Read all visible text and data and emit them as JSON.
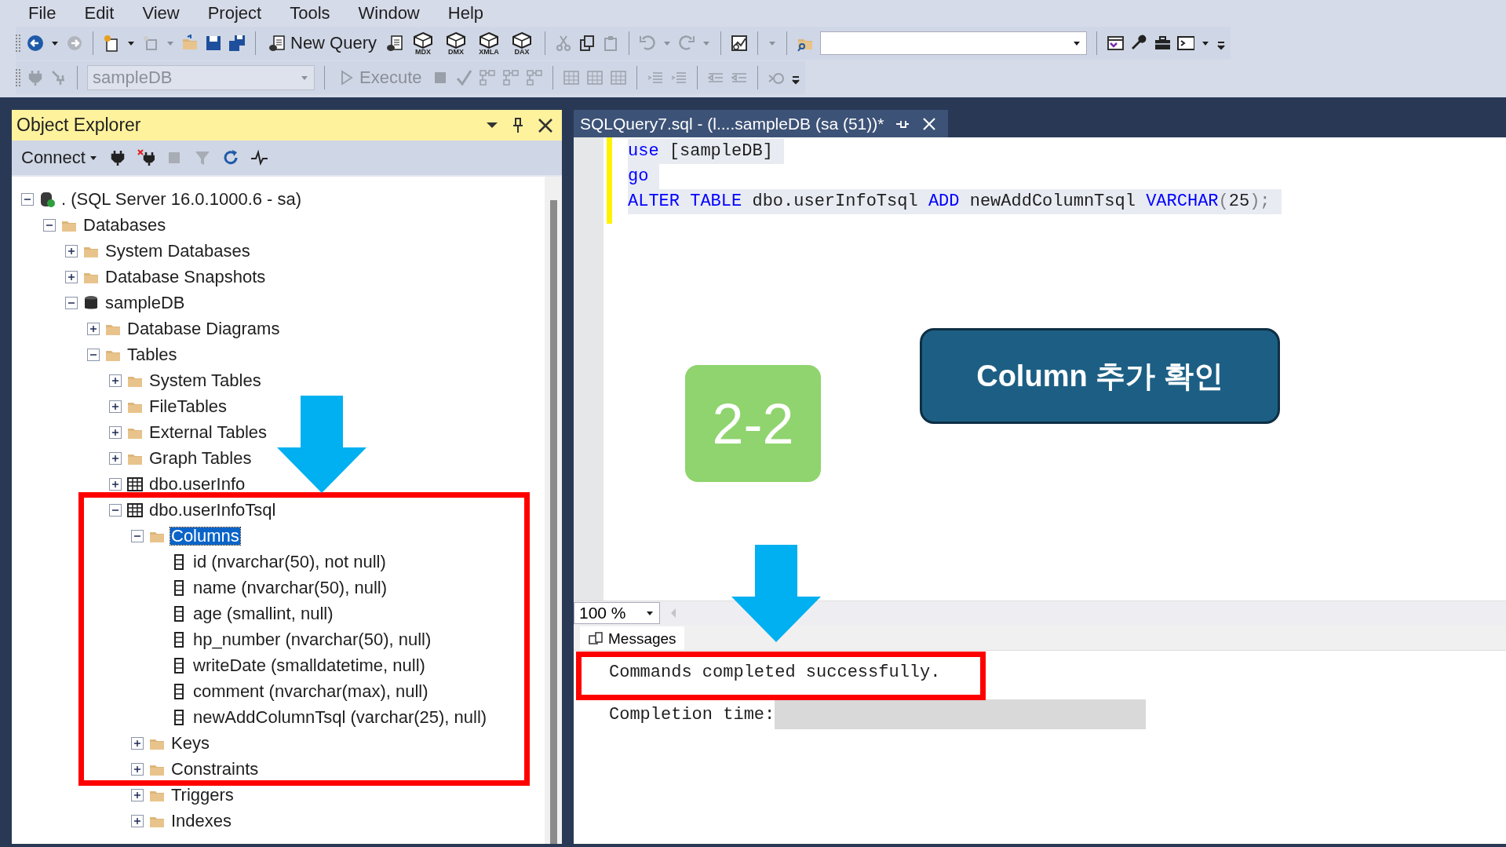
{
  "menu": [
    "File",
    "Edit",
    "View",
    "Project",
    "Tools",
    "Window",
    "Help"
  ],
  "toolbar": {
    "new_query": "New Query",
    "query_types": [
      "MDX",
      "DMX",
      "XMLA",
      "DAX"
    ]
  },
  "query_toolbar": {
    "database": {
      "value": "sampleDB",
      "disabled": true
    },
    "execute": {
      "label": "Execute",
      "disabled": true
    }
  },
  "object_explorer": {
    "title": "Object Explorer",
    "connect": "Connect",
    "tree": [
      {
        "kind": "server",
        "label": ". (SQL Server 16.0.1000.6 - sa)",
        "expanded": true,
        "selected": false,
        "children": [
          {
            "kind": "folder",
            "label": "Databases",
            "expanded": true,
            "selected": false,
            "children": [
              {
                "kind": "folder",
                "label": "System Databases",
                "expanded": false,
                "selected": false
              },
              {
                "kind": "folder",
                "label": "Database Snapshots",
                "expanded": false,
                "selected": false
              },
              {
                "kind": "database",
                "label": "sampleDB",
                "expanded": true,
                "selected": false,
                "children": [
                  {
                    "kind": "folder",
                    "label": "Database Diagrams",
                    "expanded": false,
                    "selected": false
                  },
                  {
                    "kind": "folder",
                    "label": "Tables",
                    "expanded": true,
                    "selected": false,
                    "children": [
                      {
                        "kind": "folder",
                        "label": "System Tables",
                        "expanded": false,
                        "selected": false
                      },
                      {
                        "kind": "folder",
                        "label": "FileTables",
                        "expanded": false,
                        "selected": false
                      },
                      {
                        "kind": "folder",
                        "label": "External Tables",
                        "expanded": false,
                        "selected": false
                      },
                      {
                        "kind": "folder",
                        "label": "Graph Tables",
                        "expanded": false,
                        "selected": false
                      },
                      {
                        "kind": "table",
                        "label": "dbo.userInfo",
                        "expanded": false,
                        "selected": false
                      },
                      {
                        "kind": "table",
                        "label": "dbo.userInfoTsql",
                        "expanded": true,
                        "selected": false,
                        "children": [
                          {
                            "kind": "folder",
                            "label": "Columns",
                            "expanded": true,
                            "selected": true,
                            "children": [
                              {
                                "kind": "column",
                                "label": "id (nvarchar(50), not null)",
                                "selected": false
                              },
                              {
                                "kind": "column",
                                "label": "name (nvarchar(50), null)",
                                "selected": false
                              },
                              {
                                "kind": "column",
                                "label": "age (smallint, null)",
                                "selected": false
                              },
                              {
                                "kind": "column",
                                "label": "hp_number (nvarchar(50), null)",
                                "selected": false
                              },
                              {
                                "kind": "column",
                                "label": "writeDate (smalldatetime, null)",
                                "selected": false
                              },
                              {
                                "kind": "column",
                                "label": "comment (nvarchar(max), null)",
                                "selected": false
                              },
                              {
                                "kind": "column",
                                "label": "newAddColumnTsql (varchar(25), null)",
                                "selected": false
                              }
                            ]
                          },
                          {
                            "kind": "folder",
                            "label": "Keys",
                            "expanded": false,
                            "selected": false
                          },
                          {
                            "kind": "folder",
                            "label": "Constraints",
                            "expanded": false,
                            "selected": false
                          },
                          {
                            "kind": "folder",
                            "label": "Triggers",
                            "expanded": false,
                            "selected": false
                          },
                          {
                            "kind": "folder",
                            "label": "Indexes",
                            "expanded": false,
                            "selected": false
                          }
                        ]
                      }
                    ]
                  }
                ]
              }
            ]
          }
        ]
      }
    ]
  },
  "editor": {
    "tab": "SQLQuery7.sql - (l....sampleDB (sa (51))*",
    "lines": [
      [
        {
          "kind": "keyword",
          "text": "use"
        },
        {
          "kind": "plain",
          "text": " [sampleDB]"
        }
      ],
      [
        {
          "kind": "keyword",
          "text": "go"
        }
      ],
      [
        {
          "kind": "keyword",
          "text": "ALTER TABLE"
        },
        {
          "kind": "plain",
          "text": " dbo.userInfoTsql "
        },
        {
          "kind": "keyword",
          "text": "ADD"
        },
        {
          "kind": "plain",
          "text": " newAddColumnTsql "
        },
        {
          "kind": "keyword",
          "text": "VARCHAR"
        },
        {
          "kind": "punct",
          "text": "("
        },
        {
          "kind": "plain",
          "text": "25"
        },
        {
          "kind": "punct",
          "text": ");"
        }
      ]
    ]
  },
  "results": {
    "zoom": "100 %",
    "tab": "Messages",
    "messages": [
      {
        "kind": "text",
        "text": "Commands completed successfully."
      },
      {
        "kind": "redacted",
        "text": "Completion time:"
      }
    ]
  },
  "annotations": {
    "step": "2-2",
    "callout": "Column 추가 확인"
  }
}
